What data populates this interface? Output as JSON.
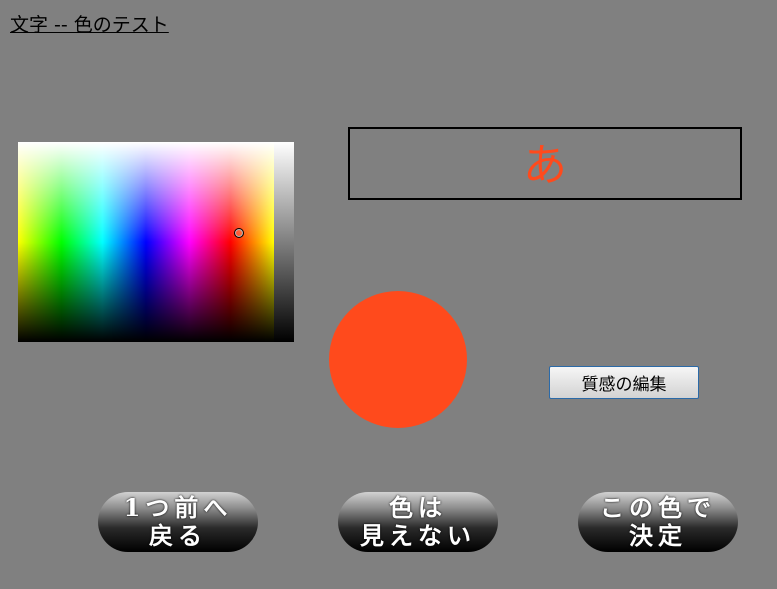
{
  "header": {
    "title": "文字 -- 色のテスト"
  },
  "preview": {
    "character": "あ",
    "color": "#ff4a1c"
  },
  "swatch": {
    "color": "#ff4a1c"
  },
  "texture_button": {
    "label": "質感の編集"
  },
  "buttons": {
    "back": {
      "line1": "1つ前へ",
      "line2": "戻る"
    },
    "invisible": {
      "line1": "色は",
      "line2": "見えない"
    },
    "decide": {
      "line1": "この色で",
      "line2": "決定"
    }
  },
  "colors": {
    "background": "#808080",
    "selected": "#ff4a1c"
  }
}
